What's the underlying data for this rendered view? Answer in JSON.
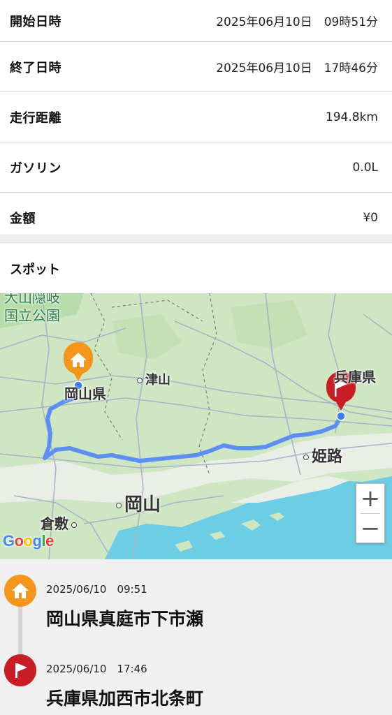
{
  "rows": [
    {
      "label": "開始日時",
      "value": "2025年06月10日　09時51分"
    },
    {
      "label": "終了日時",
      "value": "2025年06月10日　17時46分"
    },
    {
      "label": "走行距離",
      "value": "194.8km"
    },
    {
      "label": "ガソリン",
      "value": "0.0L"
    },
    {
      "label": "金額",
      "value": "¥0"
    }
  ],
  "spot_title": "スポット",
  "map": {
    "park_label_1": "大山隠岐",
    "park_label_2": "国立公園",
    "labels": {
      "okayama_pref": "岡山県",
      "tsuyama": "津山",
      "hyogo_pref": "兵庫県",
      "himeji": "姫路",
      "okayama": "岡山",
      "kurashiki": "倉敷"
    },
    "zoom_in": "+",
    "zoom_out": "−",
    "attribution": "Google",
    "start_marker_icon": "home-icon",
    "end_marker_icon": "flag-icon",
    "route_color": "#5b8ff5",
    "start_color": "#f5951c",
    "end_color": "#c81d25"
  },
  "timeline": [
    {
      "datetime": "2025/06/10　09:51",
      "address": "岡山県真庭市下市瀬",
      "icon": "home-icon"
    },
    {
      "datetime": "2025/06/10　17:46",
      "address": "兵庫県加西市北条町",
      "icon": "flag-icon"
    }
  ]
}
